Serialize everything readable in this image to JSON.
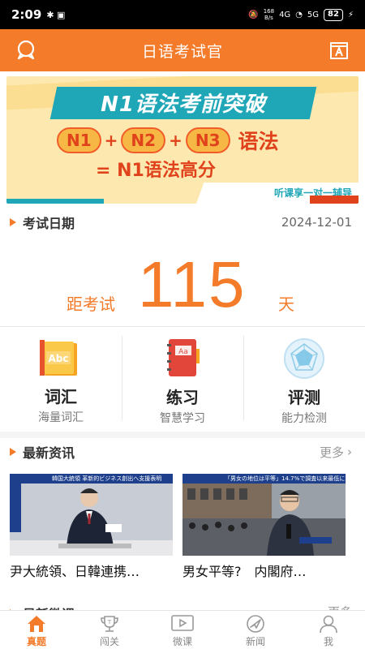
{
  "status_bar": {
    "time": "2:09",
    "net_speed_value": "168",
    "net_speed_unit": "B/s",
    "signal_1": "4G",
    "signal_2": "5G",
    "battery": "82"
  },
  "header": {
    "title": "日语考试官",
    "left_icon": "chat-bubble-icon",
    "right_icon": "dictionary-a-icon"
  },
  "banner": {
    "title": "N1语法考前突破",
    "levels": [
      "N1",
      "N2",
      "N3"
    ],
    "plus": "+",
    "grammar": "语法",
    "result": "= N1语法高分",
    "tagline": "听课享一对一辅导",
    "colors": {
      "teal": "#1fa7b7",
      "red": "#e0421b",
      "bg": "#fde9b0"
    }
  },
  "exam": {
    "label": "考试日期",
    "date": "2024-12-01",
    "prefix": "距考试",
    "days": "115",
    "suffix": "天"
  },
  "features": [
    {
      "name": "词汇",
      "sub": "海量词汇",
      "icon": "abc-book-icon"
    },
    {
      "name": "练习",
      "sub": "智慧学习",
      "icon": "notebook-icon"
    },
    {
      "name": "评测",
      "sub": "能力检测",
      "icon": "radar-chart-icon"
    }
  ],
  "news": {
    "title": "最新资讯",
    "more": "更多",
    "items": [
      {
        "caption": "尹大統領、日韓連携…",
        "headline": "韓国大統領 革新的ビジネス創出へ支援表明"
      },
      {
        "caption": "男女平等?　内閣府…",
        "headline": "「男女の地位は平等」14.7%で調査以来最低に"
      }
    ]
  },
  "micro_course": {
    "title": "最新微课",
    "more": "更多"
  },
  "tabs": [
    {
      "label": "真题",
      "icon": "home-icon",
      "active": true
    },
    {
      "label": "闯关",
      "icon": "trophy-icon",
      "active": false
    },
    {
      "label": "微课",
      "icon": "video-play-icon",
      "active": false
    },
    {
      "label": "新闻",
      "icon": "compass-icon",
      "active": false
    },
    {
      "label": "我",
      "icon": "user-icon",
      "active": false
    }
  ],
  "accent_color": "#f47b2a"
}
